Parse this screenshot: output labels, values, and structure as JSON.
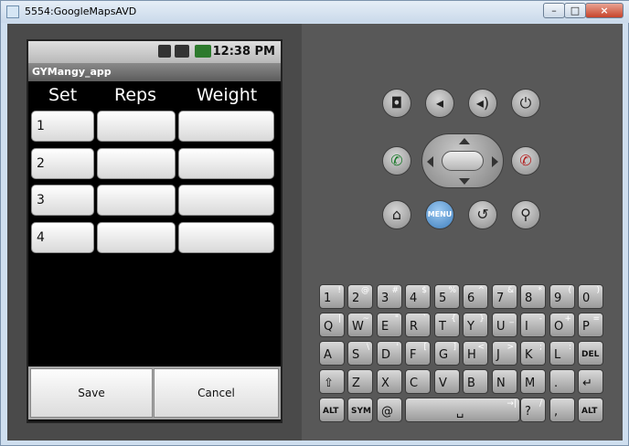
{
  "window": {
    "title": "5554:GoogleMapsAVD",
    "min": "–",
    "max": "□",
    "close": "×"
  },
  "statusbar": {
    "time": "12:38 PM"
  },
  "app": {
    "title": "GYMangy_app"
  },
  "table": {
    "headers": [
      "Set",
      "Reps",
      "Weight"
    ],
    "rows": [
      {
        "set": "1",
        "reps": "",
        "weight": ""
      },
      {
        "set": "2",
        "reps": "",
        "weight": ""
      },
      {
        "set": "3",
        "reps": "",
        "weight": ""
      },
      {
        "set": "4",
        "reps": "",
        "weight": ""
      }
    ]
  },
  "buttons": {
    "save": "Save",
    "cancel": "Cancel"
  },
  "controls": {
    "menu": "MENU"
  },
  "keyboard": {
    "rows": [
      [
        {
          "m": "1",
          "a": "!"
        },
        {
          "m": "2",
          "a": "@"
        },
        {
          "m": "3",
          "a": "#"
        },
        {
          "m": "4",
          "a": "$"
        },
        {
          "m": "5",
          "a": "%"
        },
        {
          "m": "6",
          "a": "^"
        },
        {
          "m": "7",
          "a": "&"
        },
        {
          "m": "8",
          "a": "*"
        },
        {
          "m": "9",
          "a": "("
        },
        {
          "m": "0",
          "a": ")"
        }
      ],
      [
        {
          "m": "Q",
          "a": "|"
        },
        {
          "m": "W",
          "a": "~"
        },
        {
          "m": "E",
          "a": "\""
        },
        {
          "m": "R",
          "a": "`"
        },
        {
          "m": "T",
          "a": "{"
        },
        {
          "m": "Y",
          "a": "}"
        },
        {
          "m": "U",
          "a": "_"
        },
        {
          "m": "I",
          "a": "-"
        },
        {
          "m": "O",
          "a": "+"
        },
        {
          "m": "P",
          "a": "="
        }
      ],
      [
        {
          "m": "A",
          "a": ""
        },
        {
          "m": "S",
          "a": "\\"
        },
        {
          "m": "D",
          "a": "'"
        },
        {
          "m": "F",
          "a": "["
        },
        {
          "m": "G",
          "a": "]"
        },
        {
          "m": "H",
          "a": "<"
        },
        {
          "m": "J",
          "a": ">"
        },
        {
          "m": "K",
          "a": ";"
        },
        {
          "m": "L",
          "a": ":"
        },
        {
          "m": "DEL",
          "a": ""
        }
      ],
      [
        {
          "m": "⇧",
          "a": ""
        },
        {
          "m": "Z",
          "a": ""
        },
        {
          "m": "X",
          "a": ""
        },
        {
          "m": "C",
          "a": ""
        },
        {
          "m": "V",
          "a": ""
        },
        {
          "m": "B",
          "a": ""
        },
        {
          "m": "N",
          "a": ""
        },
        {
          "m": "M",
          "a": ""
        },
        {
          "m": ".",
          "a": ""
        },
        {
          "m": "↵",
          "a": ""
        }
      ],
      [
        {
          "m": "ALT",
          "a": ""
        },
        {
          "m": "SYM",
          "a": ""
        },
        {
          "m": "@",
          "a": ""
        },
        {
          "m": "␣",
          "a": "→|"
        },
        {
          "m": "?",
          "a": "/"
        },
        {
          "m": ",",
          "a": ""
        },
        {
          "m": "ALT",
          "a": ""
        }
      ]
    ]
  }
}
